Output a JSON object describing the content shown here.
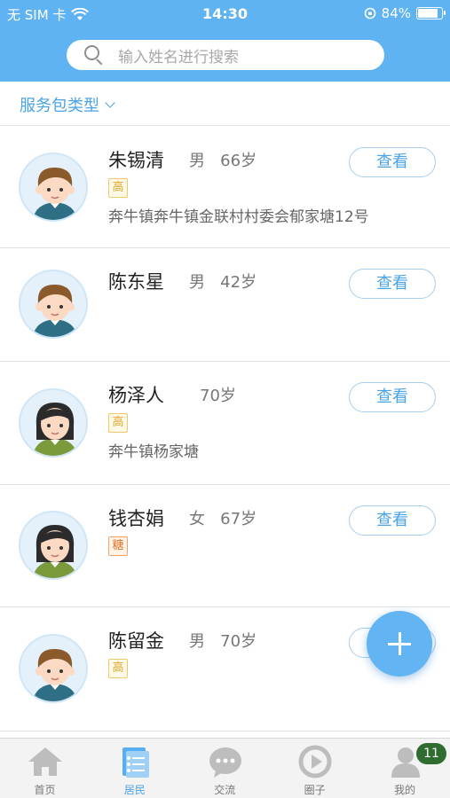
{
  "status_bar": {
    "carrier": "无 SIM 卡",
    "time": "14:30",
    "battery": "84%",
    "battery_level": 0.84
  },
  "search": {
    "placeholder": "输入姓名进行搜索",
    "icon": "search-icon"
  },
  "filter": {
    "label": "服务包类型"
  },
  "residents": [
    {
      "name": "朱锡清",
      "gender": "男",
      "age": "66岁",
      "tag": "高",
      "address": "奔牛镇奔牛镇金联村村委会郁家塘12号",
      "avatar": "boy-avatar",
      "action": "查看"
    },
    {
      "name": "陈东星",
      "gender": "男",
      "age": "42岁",
      "tag": "",
      "address": "",
      "avatar": "boy-avatar",
      "action": "查看"
    },
    {
      "name": "杨泽人",
      "gender": "",
      "age": "70岁",
      "tag": "高",
      "address": "奔牛镇杨家塘",
      "avatar": "girl-avatar",
      "action": "查看"
    },
    {
      "name": "钱杏娟",
      "gender": "女",
      "age": "67岁",
      "tag": "糖",
      "address": "",
      "avatar": "girl-avatar",
      "action": "查看"
    },
    {
      "name": "陈留金",
      "gender": "男",
      "age": "70岁",
      "tag": "高",
      "address": "",
      "avatar": "boy-avatar",
      "action": "查看"
    }
  ],
  "tabs": [
    {
      "label": "首页",
      "icon": "home-icon"
    },
    {
      "label": "居民",
      "icon": "residents-icon"
    },
    {
      "label": "交流",
      "icon": "chat-icon"
    },
    {
      "label": "圈子",
      "icon": "circle-icon"
    },
    {
      "label": "我的",
      "icon": "profile-icon",
      "badge": "11"
    }
  ],
  "colors": {
    "header": "#5fb3f2",
    "accent": "#4aa3e6",
    "fab": "#63b4f3",
    "badge": "#2f6c2f"
  }
}
